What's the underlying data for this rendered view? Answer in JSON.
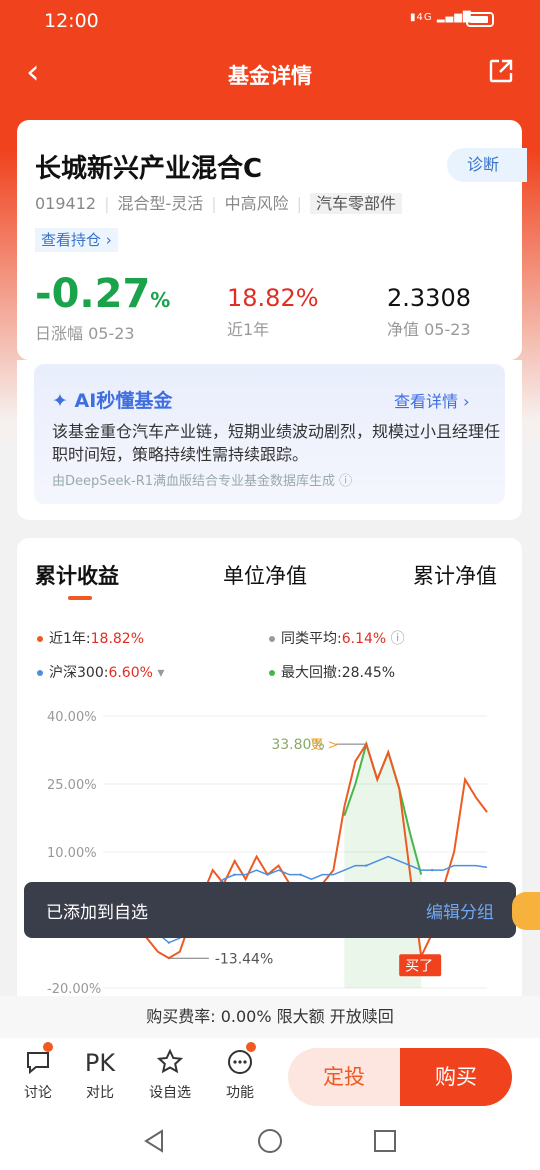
{
  "status": {
    "time": "12:00",
    "signal": "4G"
  },
  "nav": {
    "title": "基金详情"
  },
  "fund": {
    "name": "长城新兴产业混合C",
    "diagnose": "诊断",
    "code": "019412",
    "type": "混合型-灵活",
    "risk": "中高风险",
    "sector": "汽车零部件",
    "holdings": "查看持仓 ›",
    "daily_value": "-0.27",
    "daily_unit": "%",
    "daily_label": "日涨幅 05-23",
    "year_value": "18.82%",
    "year_label": "近1年",
    "nav_value": "2.3308",
    "nav_label": "净值 05-23"
  },
  "ai": {
    "title": "AI秒懂基金",
    "more": "查看详情 ›",
    "text": "该基金重仓汽车产业链，短期业绩波动剧烈，规模过小且经理任职时间短，策略持续性需持续跟踪。",
    "source": "由DeepSeek-R1满血版结合专业基金数据库生成 ⓘ"
  },
  "tabs": [
    "累计收益",
    "单位净值",
    "累计净值"
  ],
  "legend": {
    "fund": {
      "label": "近1年:",
      "value": "18.82%"
    },
    "peer": {
      "label": "同类平均:",
      "value": "6.14%"
    },
    "index": {
      "label": "沪深300:",
      "value": "6.60%"
    },
    "drawdown": {
      "label": "最大回撤:",
      "value": "28.45%"
    }
  },
  "colors": {
    "fund": "#ee5a22",
    "peer": "#9a9a9a",
    "index": "#4a8fe0",
    "drawdown": "#46b649",
    "brand": "#f0421d"
  },
  "chart_data": {
    "type": "line",
    "ytick_labels": [
      "40.00%",
      "25.00%",
      "10.00%",
      "-20.00%"
    ],
    "ylim": [
      -20,
      40
    ],
    "annotations": {
      "peak": "33.80%",
      "trough": "-13.44%",
      "update_tag": "更 >",
      "bought_tag": "买了"
    },
    "series": [
      {
        "name": "近1年",
        "values": [
          2,
          1,
          -3,
          -7,
          -9,
          -12,
          -13.4,
          -12,
          -5,
          0,
          6,
          3,
          8,
          4,
          9,
          5,
          7,
          3,
          2,
          1,
          3,
          6,
          20,
          30,
          33.8,
          26,
          32,
          24,
          5,
          -13,
          -8,
          2,
          10,
          26,
          22,
          18.8
        ]
      },
      {
        "name": "沪深300",
        "values": [
          2,
          1,
          0,
          -3,
          -5,
          -8,
          -10,
          -9,
          -6,
          -2,
          2,
          4,
          5,
          5,
          6,
          5,
          6,
          5,
          5,
          4,
          5,
          5,
          6,
          7,
          7,
          8,
          9,
          8,
          7,
          6,
          6,
          6,
          7,
          7,
          7,
          6.6
        ]
      }
    ],
    "drawdown_series": {
      "name": "最大回撤",
      "values": [
        18,
        25,
        33.8,
        26,
        32,
        24,
        14,
        5
      ]
    }
  },
  "toast": {
    "message": "已添加到自选",
    "action": "编辑分组"
  },
  "footer": {
    "fee": "购买费率: 0.00% 限大额 开放赎回",
    "items": [
      {
        "icon": "chat-icon",
        "label": "讨论"
      },
      {
        "icon": "pk-icon",
        "text": "PK",
        "label": "对比"
      },
      {
        "icon": "star-icon",
        "label": "设自选"
      },
      {
        "icon": "more-icon",
        "label": "功能"
      }
    ],
    "dingtou": "定投",
    "buy": "购买"
  }
}
